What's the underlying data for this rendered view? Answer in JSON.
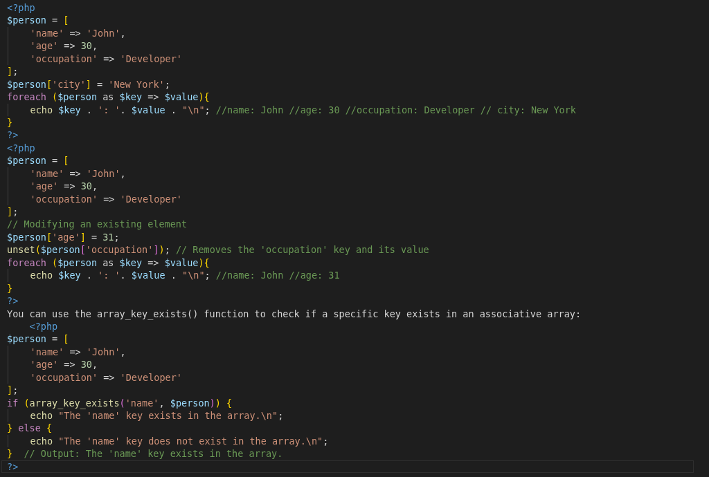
{
  "editor": {
    "lines": [
      {
        "current": false,
        "indented": false,
        "tokens": [
          {
            "kind": "tag",
            "text": "<?php"
          }
        ]
      },
      {
        "current": false,
        "indented": false,
        "tokens": [
          {
            "kind": "var",
            "text": "$person"
          },
          {
            "kind": "op",
            "text": " = "
          },
          {
            "kind": "br1",
            "text": "["
          }
        ]
      },
      {
        "current": false,
        "indented": true,
        "tokens": [
          {
            "kind": "str",
            "text": "'name'"
          },
          {
            "kind": "op",
            "text": " => "
          },
          {
            "kind": "str",
            "text": "'John'"
          },
          {
            "kind": "op",
            "text": ","
          }
        ]
      },
      {
        "current": false,
        "indented": true,
        "tokens": [
          {
            "kind": "str",
            "text": "'age'"
          },
          {
            "kind": "op",
            "text": " => "
          },
          {
            "kind": "num",
            "text": "30"
          },
          {
            "kind": "op",
            "text": ","
          }
        ]
      },
      {
        "current": false,
        "indented": true,
        "tokens": [
          {
            "kind": "str",
            "text": "'occupation'"
          },
          {
            "kind": "op",
            "text": " => "
          },
          {
            "kind": "str",
            "text": "'Developer'"
          }
        ]
      },
      {
        "current": false,
        "indented": false,
        "tokens": [
          {
            "kind": "br1",
            "text": "]"
          },
          {
            "kind": "op",
            "text": ";"
          }
        ]
      },
      {
        "current": false,
        "indented": false,
        "tokens": [
          {
            "kind": "var",
            "text": "$person"
          },
          {
            "kind": "br1",
            "text": "["
          },
          {
            "kind": "str",
            "text": "'city'"
          },
          {
            "kind": "br1",
            "text": "]"
          },
          {
            "kind": "op",
            "text": " = "
          },
          {
            "kind": "str",
            "text": "'New York'"
          },
          {
            "kind": "op",
            "text": ";"
          }
        ]
      },
      {
        "current": false,
        "indented": false,
        "tokens": [
          {
            "kind": "kw",
            "text": "foreach "
          },
          {
            "kind": "br1",
            "text": "("
          },
          {
            "kind": "var",
            "text": "$person"
          },
          {
            "kind": "op",
            "text": " as "
          },
          {
            "kind": "var",
            "text": "$key"
          },
          {
            "kind": "op",
            "text": " => "
          },
          {
            "kind": "var",
            "text": "$value"
          },
          {
            "kind": "br1",
            "text": "){"
          }
        ]
      },
      {
        "current": false,
        "indented": true,
        "tokens": [
          {
            "kind": "fn",
            "text": "echo "
          },
          {
            "kind": "var",
            "text": "$key"
          },
          {
            "kind": "op",
            "text": " . "
          },
          {
            "kind": "str",
            "text": "': '"
          },
          {
            "kind": "op",
            "text": ". "
          },
          {
            "kind": "var",
            "text": "$value"
          },
          {
            "kind": "op",
            "text": " . "
          },
          {
            "kind": "str",
            "text": "\"\\n\""
          },
          {
            "kind": "op",
            "text": "; "
          },
          {
            "kind": "com",
            "text": "//name: John //age: 30 //occupation: Developer // city: New York"
          }
        ]
      },
      {
        "current": false,
        "indented": false,
        "tokens": [
          {
            "kind": "br1",
            "text": "}"
          }
        ]
      },
      {
        "current": false,
        "indented": false,
        "tokens": [
          {
            "kind": "tag",
            "text": "?>"
          }
        ]
      },
      {
        "current": false,
        "indented": false,
        "tokens": [
          {
            "kind": "tag",
            "text": "<?php"
          }
        ]
      },
      {
        "current": false,
        "indented": false,
        "tokens": [
          {
            "kind": "var",
            "text": "$person"
          },
          {
            "kind": "op",
            "text": " = "
          },
          {
            "kind": "br1",
            "text": "["
          }
        ]
      },
      {
        "current": false,
        "indented": true,
        "tokens": [
          {
            "kind": "str",
            "text": "'name'"
          },
          {
            "kind": "op",
            "text": " => "
          },
          {
            "kind": "str",
            "text": "'John'"
          },
          {
            "kind": "op",
            "text": ","
          }
        ]
      },
      {
        "current": false,
        "indented": true,
        "tokens": [
          {
            "kind": "str",
            "text": "'age'"
          },
          {
            "kind": "op",
            "text": " => "
          },
          {
            "kind": "num",
            "text": "30"
          },
          {
            "kind": "op",
            "text": ","
          }
        ]
      },
      {
        "current": false,
        "indented": true,
        "tokens": [
          {
            "kind": "str",
            "text": "'occupation'"
          },
          {
            "kind": "op",
            "text": " => "
          },
          {
            "kind": "str",
            "text": "'Developer'"
          }
        ]
      },
      {
        "current": false,
        "indented": false,
        "tokens": [
          {
            "kind": "br1",
            "text": "]"
          },
          {
            "kind": "op",
            "text": ";"
          }
        ]
      },
      {
        "current": false,
        "indented": false,
        "tokens": [
          {
            "kind": "com",
            "text": "// Modifying an existing element"
          }
        ]
      },
      {
        "current": false,
        "indented": false,
        "tokens": [
          {
            "kind": "var",
            "text": "$person"
          },
          {
            "kind": "br1",
            "text": "["
          },
          {
            "kind": "str",
            "text": "'age'"
          },
          {
            "kind": "br1",
            "text": "]"
          },
          {
            "kind": "op",
            "text": " = "
          },
          {
            "kind": "num",
            "text": "31"
          },
          {
            "kind": "op",
            "text": ";"
          }
        ]
      },
      {
        "current": false,
        "indented": false,
        "tokens": [
          {
            "kind": "fn",
            "text": "unset"
          },
          {
            "kind": "br1",
            "text": "("
          },
          {
            "kind": "var",
            "text": "$person"
          },
          {
            "kind": "br2",
            "text": "["
          },
          {
            "kind": "str",
            "text": "'occupation'"
          },
          {
            "kind": "br2",
            "text": "]"
          },
          {
            "kind": "br1",
            "text": ")"
          },
          {
            "kind": "op",
            "text": "; "
          },
          {
            "kind": "com",
            "text": "// Removes the 'occupation' key and its value"
          }
        ]
      },
      {
        "current": false,
        "indented": false,
        "tokens": [
          {
            "kind": "kw",
            "text": "foreach "
          },
          {
            "kind": "br1",
            "text": "("
          },
          {
            "kind": "var",
            "text": "$person"
          },
          {
            "kind": "op",
            "text": " as "
          },
          {
            "kind": "var",
            "text": "$key"
          },
          {
            "kind": "op",
            "text": " => "
          },
          {
            "kind": "var",
            "text": "$value"
          },
          {
            "kind": "br1",
            "text": "){"
          }
        ]
      },
      {
        "current": false,
        "indented": true,
        "tokens": [
          {
            "kind": "fn",
            "text": "echo "
          },
          {
            "kind": "var",
            "text": "$key"
          },
          {
            "kind": "op",
            "text": " . "
          },
          {
            "kind": "str",
            "text": "': '"
          },
          {
            "kind": "op",
            "text": ". "
          },
          {
            "kind": "var",
            "text": "$value"
          },
          {
            "kind": "op",
            "text": " . "
          },
          {
            "kind": "str",
            "text": "\"\\n\""
          },
          {
            "kind": "op",
            "text": "; "
          },
          {
            "kind": "com",
            "text": "//name: John //age: 31"
          }
        ]
      },
      {
        "current": false,
        "indented": false,
        "tokens": [
          {
            "kind": "br1",
            "text": "}"
          }
        ]
      },
      {
        "current": false,
        "indented": false,
        "tokens": [
          {
            "kind": "tag",
            "text": "?>"
          }
        ]
      },
      {
        "current": false,
        "indented": false,
        "tokens": [
          {
            "kind": "op",
            "text": "You can use the array_key_exists() function to check if a specific key exists in an associative array:"
          }
        ]
      },
      {
        "current": false,
        "indented": false,
        "tokens": [
          {
            "kind": "tag",
            "text": "    <?php"
          }
        ]
      },
      {
        "current": false,
        "indented": false,
        "tokens": [
          {
            "kind": "var",
            "text": "$person"
          },
          {
            "kind": "op",
            "text": " = "
          },
          {
            "kind": "br1",
            "text": "["
          }
        ]
      },
      {
        "current": false,
        "indented": true,
        "tokens": [
          {
            "kind": "str",
            "text": "'name'"
          },
          {
            "kind": "op",
            "text": " => "
          },
          {
            "kind": "str",
            "text": "'John'"
          },
          {
            "kind": "op",
            "text": ","
          }
        ]
      },
      {
        "current": false,
        "indented": true,
        "tokens": [
          {
            "kind": "str",
            "text": "'age'"
          },
          {
            "kind": "op",
            "text": " => "
          },
          {
            "kind": "num",
            "text": "30"
          },
          {
            "kind": "op",
            "text": ","
          }
        ]
      },
      {
        "current": false,
        "indented": true,
        "tokens": [
          {
            "kind": "str",
            "text": "'occupation'"
          },
          {
            "kind": "op",
            "text": " => "
          },
          {
            "kind": "str",
            "text": "'Developer'"
          }
        ]
      },
      {
        "current": false,
        "indented": false,
        "tokens": [
          {
            "kind": "br1",
            "text": "]"
          },
          {
            "kind": "op",
            "text": ";"
          }
        ]
      },
      {
        "current": false,
        "indented": false,
        "tokens": [
          {
            "kind": "kw",
            "text": "if "
          },
          {
            "kind": "br1",
            "text": "("
          },
          {
            "kind": "fn",
            "text": "array_key_exists"
          },
          {
            "kind": "br2",
            "text": "("
          },
          {
            "kind": "str",
            "text": "'name'"
          },
          {
            "kind": "op",
            "text": ", "
          },
          {
            "kind": "var",
            "text": "$person"
          },
          {
            "kind": "br2",
            "text": ")"
          },
          {
            "kind": "br1",
            "text": ")"
          },
          {
            "kind": "br1",
            "text": " {"
          }
        ]
      },
      {
        "current": false,
        "indented": true,
        "tokens": [
          {
            "kind": "fn",
            "text": "echo "
          },
          {
            "kind": "str",
            "text": "\"The 'name' key exists in the array.\\n\""
          },
          {
            "kind": "op",
            "text": ";"
          }
        ]
      },
      {
        "current": false,
        "indented": false,
        "tokens": [
          {
            "kind": "br1",
            "text": "} "
          },
          {
            "kind": "kw",
            "text": "else "
          },
          {
            "kind": "br1",
            "text": "{"
          }
        ]
      },
      {
        "current": false,
        "indented": true,
        "tokens": [
          {
            "kind": "fn",
            "text": "echo "
          },
          {
            "kind": "str",
            "text": "\"The 'name' key does not exist in the array.\\n\""
          },
          {
            "kind": "op",
            "text": ";"
          }
        ]
      },
      {
        "current": false,
        "indented": false,
        "tokens": [
          {
            "kind": "br1",
            "text": "}"
          },
          {
            "kind": "com",
            "text": "  // Output: The 'name' key exists in the array."
          }
        ]
      },
      {
        "current": true,
        "indented": false,
        "tokens": [
          {
            "kind": "tag",
            "text": "?>"
          }
        ]
      }
    ]
  }
}
